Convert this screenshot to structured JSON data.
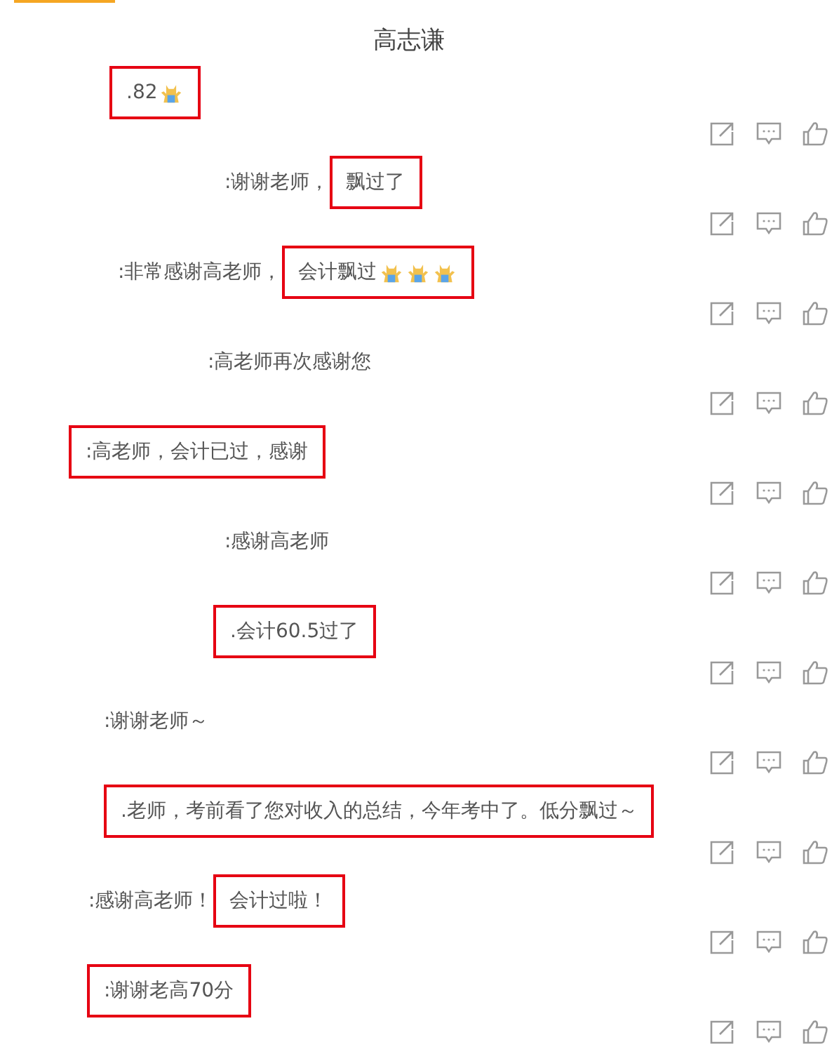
{
  "title": "高志谦",
  "comments": [
    {
      "segments": [
        {
          "highlighted": true,
          "items": [
            {
              "kind": "text",
              "text": ".82"
            },
            {
              "kind": "emoji"
            }
          ]
        }
      ]
    },
    {
      "segments": [
        {
          "highlighted": false,
          "items": [
            {
              "kind": "text",
              "text": ":谢谢老师，"
            }
          ]
        },
        {
          "highlighted": true,
          "items": [
            {
              "kind": "text",
              "text": "飘过了"
            }
          ]
        }
      ]
    },
    {
      "segments": [
        {
          "highlighted": false,
          "items": [
            {
              "kind": "text",
              "text": ":非常感谢高老师，"
            }
          ]
        },
        {
          "highlighted": true,
          "items": [
            {
              "kind": "text",
              "text": "会计飘过"
            },
            {
              "kind": "emoji"
            },
            {
              "kind": "emoji"
            },
            {
              "kind": "emoji"
            }
          ]
        }
      ]
    },
    {
      "segments": [
        {
          "highlighted": false,
          "items": [
            {
              "kind": "text",
              "text": ":高老师再次感谢您"
            }
          ]
        }
      ]
    },
    {
      "segments": [
        {
          "highlighted": true,
          "items": [
            {
              "kind": "text",
              "text": ":高老师，会计已过，感谢"
            }
          ]
        }
      ]
    },
    {
      "segments": [
        {
          "highlighted": false,
          "items": [
            {
              "kind": "text",
              "text": ":感谢高老师"
            }
          ]
        }
      ]
    },
    {
      "segments": [
        {
          "highlighted": true,
          "items": [
            {
              "kind": "text",
              "text": ".会计60.5过了"
            }
          ]
        }
      ]
    },
    {
      "segments": [
        {
          "highlighted": false,
          "items": [
            {
              "kind": "text",
              "text": ":谢谢老师～"
            }
          ]
        }
      ]
    },
    {
      "segments": [
        {
          "highlighted": true,
          "items": [
            {
              "kind": "text",
              "text": ".老师，考前看了您对收入的总结，今年考中了。低分飘过～"
            }
          ]
        }
      ]
    },
    {
      "segments": [
        {
          "highlighted": false,
          "items": [
            {
              "kind": "text",
              "text": ":感谢高老师！"
            }
          ]
        },
        {
          "highlighted": true,
          "items": [
            {
              "kind": "text",
              "text": "会计过啦！"
            }
          ]
        }
      ]
    },
    {
      "segments": [
        {
          "highlighted": true,
          "items": [
            {
              "kind": "text",
              "text": ":谢谢老高70分"
            }
          ]
        }
      ]
    }
  ]
}
